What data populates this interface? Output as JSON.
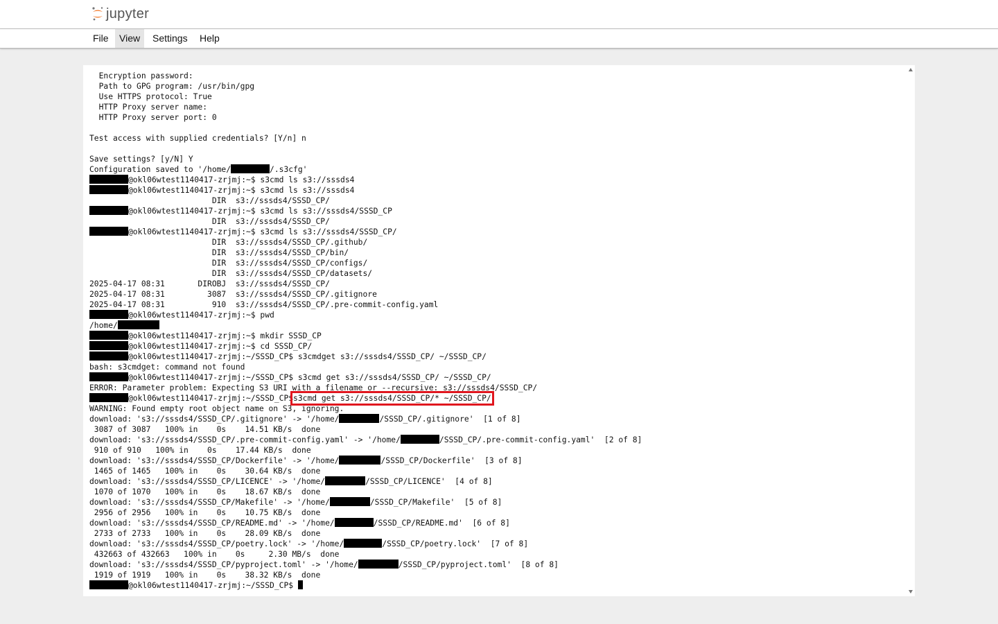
{
  "app": {
    "logo_text": "jupyter",
    "logo_icon": "jupyter-logo-icon",
    "brand_color": "#f37726"
  },
  "menu": {
    "items": [
      "File",
      "View",
      "Settings",
      "Help"
    ],
    "active": "View"
  },
  "terminal": {
    "highlight_color": "#e0161e",
    "lines": [
      {
        "parts": [
          {
            "t": "  Encryption password:"
          }
        ]
      },
      {
        "parts": [
          {
            "t": "  Path to GPG program: /usr/bin/gpg"
          }
        ]
      },
      {
        "parts": [
          {
            "t": "  Use HTTPS protocol: True"
          }
        ]
      },
      {
        "parts": [
          {
            "t": "  HTTP Proxy server name:"
          }
        ]
      },
      {
        "parts": [
          {
            "t": "  HTTP Proxy server port: 0"
          }
        ]
      },
      {
        "parts": [
          {
            "t": ""
          }
        ]
      },
      {
        "parts": [
          {
            "t": "Test access with supplied credentials? [Y/n] n"
          }
        ]
      },
      {
        "parts": [
          {
            "t": ""
          }
        ]
      },
      {
        "parts": [
          {
            "t": "Save settings? [y/N] Y"
          }
        ]
      },
      {
        "parts": [
          {
            "t": "Configuration saved to '/home/"
          },
          {
            "r": 8
          },
          {
            "t": "/.s3cfg'"
          }
        ]
      },
      {
        "parts": [
          {
            "r": 8
          },
          {
            "t": "@okl06wtest1140417-zrjmj:~$ s3cmd ls s3://sssds4"
          }
        ]
      },
      {
        "parts": [
          {
            "r": 8
          },
          {
            "t": "@okl06wtest1140417-zrjmj:~$ s3cmd ls s3://sssds4"
          }
        ]
      },
      {
        "parts": [
          {
            "t": "                          DIR  s3://sssds4/SSSD_CP/"
          }
        ]
      },
      {
        "parts": [
          {
            "r": 8
          },
          {
            "t": "@okl06wtest1140417-zrjmj:~$ s3cmd ls s3://sssds4/SSSD_CP"
          }
        ]
      },
      {
        "parts": [
          {
            "t": "                          DIR  s3://sssds4/SSSD_CP/"
          }
        ]
      },
      {
        "parts": [
          {
            "r": 8
          },
          {
            "t": "@okl06wtest1140417-zrjmj:~$ s3cmd ls s3://sssds4/SSSD_CP/"
          }
        ]
      },
      {
        "parts": [
          {
            "t": "                          DIR  s3://sssds4/SSSD_CP/.github/"
          }
        ]
      },
      {
        "parts": [
          {
            "t": "                          DIR  s3://sssds4/SSSD_CP/bin/"
          }
        ]
      },
      {
        "parts": [
          {
            "t": "                          DIR  s3://sssds4/SSSD_CP/configs/"
          }
        ]
      },
      {
        "parts": [
          {
            "t": "                          DIR  s3://sssds4/SSSD_CP/datasets/"
          }
        ]
      },
      {
        "parts": [
          {
            "t": "2025-04-17 08:31       DIROBJ  s3://sssds4/SSSD_CP/"
          }
        ]
      },
      {
        "parts": [
          {
            "t": "2025-04-17 08:31         3087  s3://sssds4/SSSD_CP/.gitignore"
          }
        ]
      },
      {
        "parts": [
          {
            "t": "2025-04-17 08:31          910  s3://sssds4/SSSD_CP/.pre-commit-config.yaml"
          }
        ]
      },
      {
        "parts": [
          {
            "r": 8
          },
          {
            "t": "@okl06wtest1140417-zrjmj:~$ pwd"
          }
        ]
      },
      {
        "parts": [
          {
            "t": "/home/"
          },
          {
            "r": 8.5
          }
        ]
      },
      {
        "parts": [
          {
            "r": 8
          },
          {
            "t": "@okl06wtest1140417-zrjmj:~$ mkdir SSSD_CP"
          }
        ]
      },
      {
        "parts": [
          {
            "r": 8
          },
          {
            "t": "@okl06wtest1140417-zrjmj:~$ cd SSSD_CP/"
          }
        ]
      },
      {
        "parts": [
          {
            "r": 8
          },
          {
            "t": "@okl06wtest1140417-zrjmj:~/SSSD_CP$ s3cmdget s3://sssds4/SSSD_CP/ ~/SSSD_CP/"
          }
        ]
      },
      {
        "parts": [
          {
            "t": "bash: s3cmdget: command not found"
          }
        ]
      },
      {
        "parts": [
          {
            "r": 8
          },
          {
            "t": "@okl06wtest1140417-zrjmj:~/SSSD_CP$ s3cmd get s3://sssds4/SSSD_CP/ ~/SSSD_CP/"
          }
        ]
      },
      {
        "parts": [
          {
            "t": "ERROR: Parameter problem: Expecting S3 URI with a filename or --recursive: s3://sssds4/SSSD_CP/"
          }
        ]
      },
      {
        "parts": [
          {
            "r": 8
          },
          {
            "t": "@okl06wtest1140417-zrjmj:~/SSSD_CP$"
          },
          {
            "h": "s3cmd get s3://sssds4/SSSD_CP/* ~/SSSD_CP/"
          }
        ]
      },
      {
        "parts": [
          {
            "t": "WARNING: Found empty root object name on S3, ignoring."
          }
        ]
      },
      {
        "parts": [
          {
            "t": "download: 's3://sssds4/SSSD_CP/.gitignore' -> '/home/"
          },
          {
            "r": 8.3
          },
          {
            "t": "/SSSD_CP/.gitignore'  [1 of 8]"
          }
        ]
      },
      {
        "parts": [
          {
            "t": " 3087 of 3087   100% in    0s    14.51 KB/s  done"
          }
        ]
      },
      {
        "parts": [
          {
            "t": "download: 's3://sssds4/SSSD_CP/.pre-commit-config.yaml' -> '/home/"
          },
          {
            "r": 8
          },
          {
            "t": "/SSSD_CP/.pre-commit-config.yaml'  [2 of 8]"
          }
        ]
      },
      {
        "parts": [
          {
            "t": " 910 of 910   100% in    0s    17.44 KB/s  done"
          }
        ]
      },
      {
        "parts": [
          {
            "t": "download: 's3://sssds4/SSSD_CP/Dockerfile' -> '/home/"
          },
          {
            "r": 8.5
          },
          {
            "t": "/SSSD_CP/Dockerfile'  [3 of 8]"
          }
        ]
      },
      {
        "parts": [
          {
            "t": " 1465 of 1465   100% in    0s    30.64 KB/s  done"
          }
        ]
      },
      {
        "parts": [
          {
            "t": "download: 's3://sssds4/SSSD_CP/LICENCE' -> '/home/"
          },
          {
            "r": 8.3
          },
          {
            "t": "/SSSD_CP/LICENCE'  [4 of 8]"
          }
        ]
      },
      {
        "parts": [
          {
            "t": " 1070 of 1070   100% in    0s    18.67 KB/s  done"
          }
        ]
      },
      {
        "parts": [
          {
            "t": "download: 's3://sssds4/SSSD_CP/Makefile' -> '/home/"
          },
          {
            "r": 8.3
          },
          {
            "t": "/SSSD_CP/Makefile'  [5 of 8]"
          }
        ]
      },
      {
        "parts": [
          {
            "t": " 2956 of 2956   100% in    0s    10.75 KB/s  done"
          }
        ]
      },
      {
        "parts": [
          {
            "t": "download: 's3://sssds4/SSSD_CP/README.md' -> '/home/"
          },
          {
            "r": 8
          },
          {
            "t": "/SSSD_CP/README.md'  [6 of 8]"
          }
        ]
      },
      {
        "parts": [
          {
            "t": " 2733 of 2733   100% in    0s    28.09 KB/s  done"
          }
        ]
      },
      {
        "parts": [
          {
            "t": "download: 's3://sssds4/SSSD_CP/poetry.lock' -> '/home/"
          },
          {
            "r": 7.8
          },
          {
            "t": "/SSSD_CP/poetry.lock'  [7 of 8]"
          }
        ]
      },
      {
        "parts": [
          {
            "t": " 432663 of 432663   100% in    0s     2.30 MB/s  done"
          }
        ]
      },
      {
        "parts": [
          {
            "t": "download: 's3://sssds4/SSSD_CP/pyproject.toml' -> '/home/"
          },
          {
            "r": 8.3
          },
          {
            "t": "/SSSD_CP/pyproject.toml'  [8 of 8]"
          }
        ]
      },
      {
        "parts": [
          {
            "t": " 1919 of 1919   100% in    0s    38.32 KB/s  done"
          }
        ]
      },
      {
        "parts": [
          {
            "r": 8
          },
          {
            "t": "@okl06wtest1140417-zrjmj:~/SSSD_CP$ "
          },
          {
            "c": true
          }
        ]
      }
    ]
  }
}
